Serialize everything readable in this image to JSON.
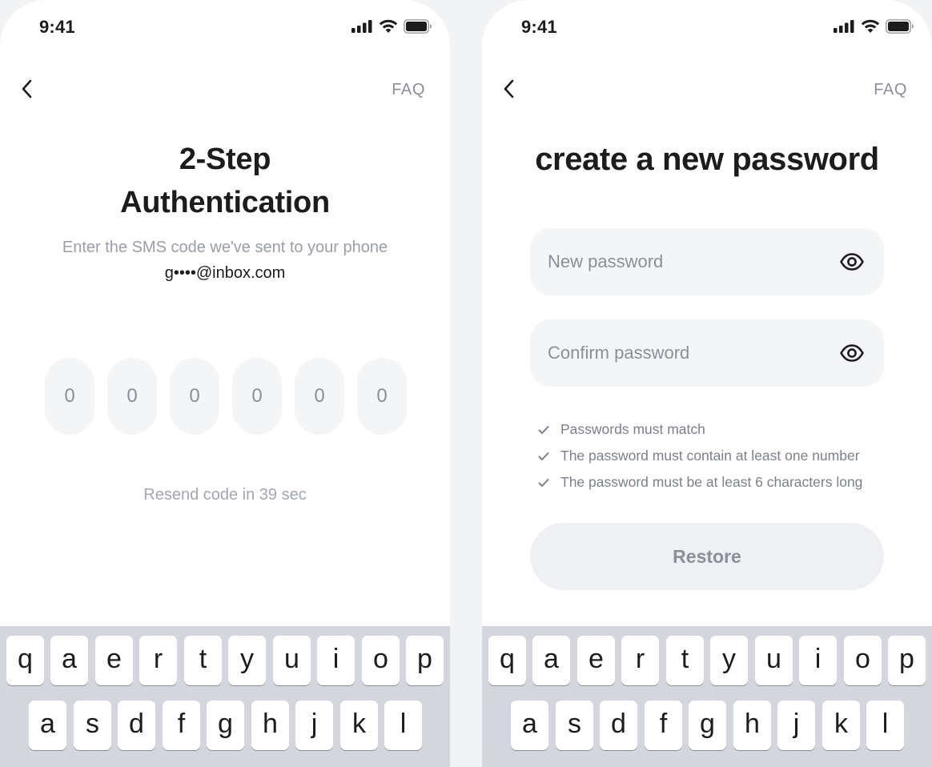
{
  "status_bar": {
    "time": "9:41"
  },
  "verify_screen": {
    "faq_label": "FAQ",
    "title_line1": "2-Step",
    "title_line2": "Authentication",
    "subtitle": "Enter the SMS code we've sent to your phone",
    "email": "g••••@inbox.com",
    "code_digits": [
      "0",
      "0",
      "0",
      "0",
      "0",
      "0"
    ],
    "resend_text": "Resend code in 39 sec"
  },
  "password_screen": {
    "faq_label": "FAQ",
    "title": "create a new password",
    "new_password": {
      "placeholder": "New password",
      "value": ""
    },
    "confirm_password": {
      "placeholder": "Confirm password",
      "value": ""
    },
    "rules": [
      "Passwords must match",
      "The password must contain at least one number",
      "The password must be at least 6 characters long"
    ],
    "restore_label": "Restore"
  },
  "keyboard": {
    "row1": [
      "q",
      "a",
      "e",
      "r",
      "t",
      "y",
      "u",
      "i",
      "o",
      "p"
    ],
    "row2": [
      "a",
      "s",
      "d",
      "f",
      "g",
      "h",
      "j",
      "k",
      "l"
    ]
  }
}
